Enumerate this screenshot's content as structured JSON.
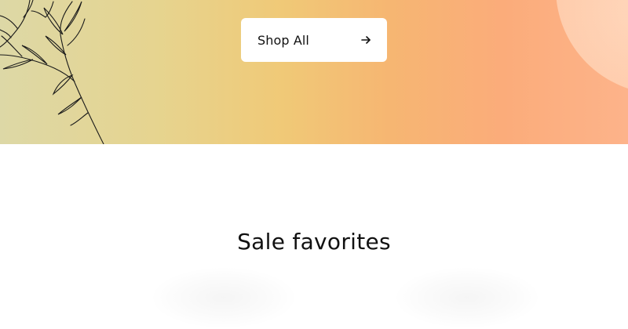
{
  "hero": {
    "cta_label": "Shop All",
    "cta_icon": "arrow-right-icon",
    "decoration_icon": "leafy-branch-illustration",
    "gradient_start": "#ddd8a6",
    "gradient_end": "#fdb38a"
  },
  "sale_section": {
    "title": "Sale favorites"
  }
}
